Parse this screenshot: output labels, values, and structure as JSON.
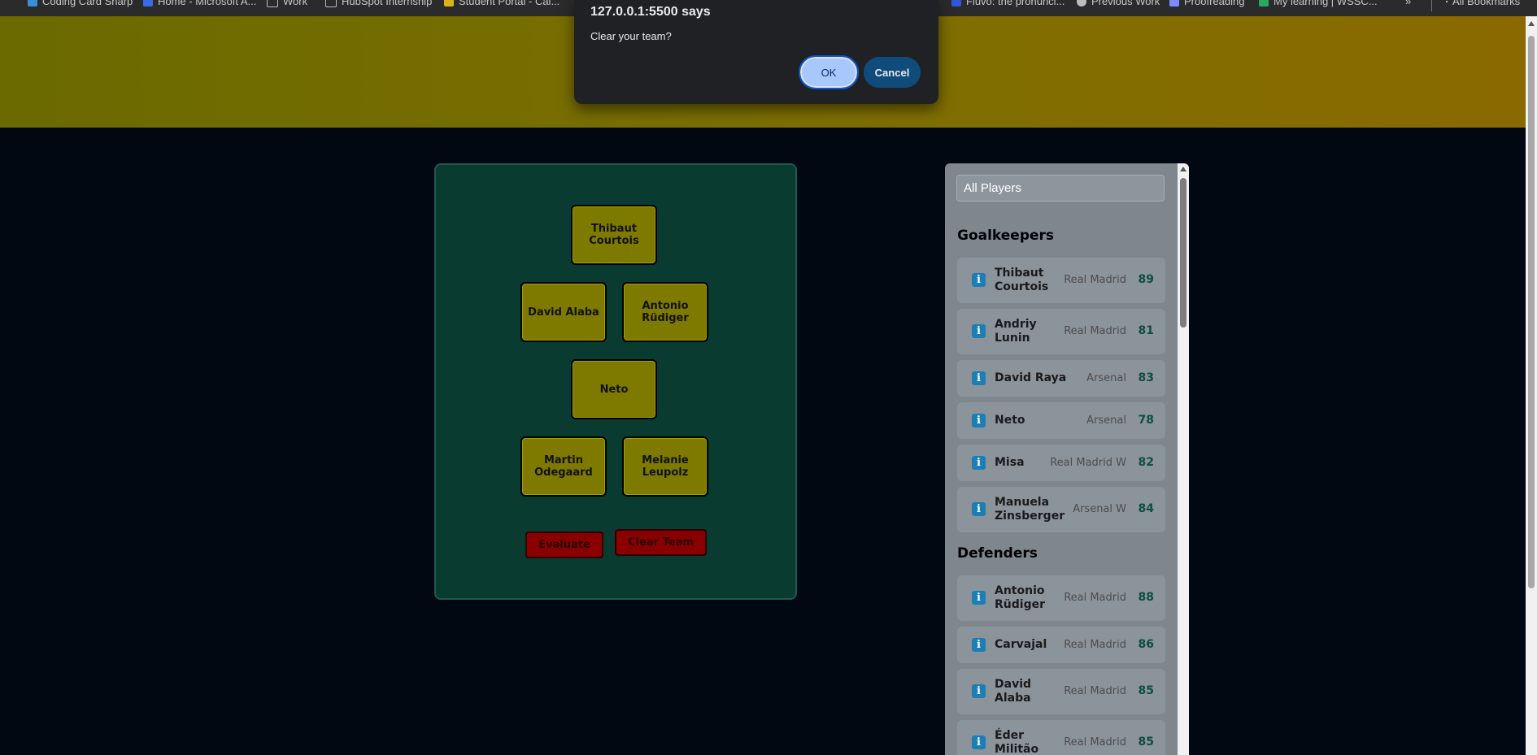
{
  "bookmarks": {
    "items": [
      {
        "label": "Coding Card Sharp",
        "color": "#3a8fd8"
      },
      {
        "label": "Home - Microsoft A...",
        "color": "#3c6ae0"
      },
      {
        "label": "Work",
        "color": "#9a9a9a"
      },
      {
        "label": "HubSpot Internship",
        "color": "#9a9a9a"
      },
      {
        "label": "Student Portal - Cal...",
        "color": "#d8b31c"
      },
      {
        "label": "Fluvo: the pronunci...",
        "color": "#3355dd"
      },
      {
        "label": "Previous Work",
        "color": "#bdbdbd"
      },
      {
        "label": "Proofreading",
        "color": "#7b8cff"
      },
      {
        "label": "My learning | WSSC...",
        "color": "#2aa860"
      }
    ],
    "overflow": "»",
    "all_bookmarks": "All Bookmarks"
  },
  "dialog": {
    "title": "127.0.0.1:5500 says",
    "message": "Clear your team?",
    "ok_label": "OK",
    "cancel_label": "Cancel"
  },
  "pitch": {
    "slots": [
      {
        "name": "Thibaut Courtois"
      },
      {
        "name": "David Alaba"
      },
      {
        "name": "Antonio Rüdiger"
      },
      {
        "name": "Neto"
      },
      {
        "name": "Martin Odegaard"
      },
      {
        "name": "Melanie Leupolz"
      }
    ],
    "evaluate_label": "Evaluate",
    "clear_label": "Clear Team"
  },
  "player_list": {
    "filter_value": "All Players",
    "sections": [
      {
        "title": "Goalkeepers",
        "players": [
          {
            "name": "Thibaut Courtois",
            "club": "Real Madrid",
            "rating": "89"
          },
          {
            "name": "Andriy Lunin",
            "club": "Real Madrid",
            "rating": "81"
          },
          {
            "name": "David Raya",
            "club": "Arsenal",
            "rating": "83"
          },
          {
            "name": "Neto",
            "club": "Arsenal",
            "rating": "78"
          },
          {
            "name": "Misa",
            "club": "Real Madrid W",
            "rating": "82"
          },
          {
            "name": "Manuela Zinsberger",
            "club": "Arsenal W",
            "rating": "84"
          }
        ]
      },
      {
        "title": "Defenders",
        "players": [
          {
            "name": "Antonio Rüdiger",
            "club": "Real Madrid",
            "rating": "88"
          },
          {
            "name": "Carvajal",
            "club": "Real Madrid",
            "rating": "86"
          },
          {
            "name": "David Alaba",
            "club": "Real Madrid",
            "rating": "85"
          },
          {
            "name": "Éder Militão",
            "club": "Real Madrid",
            "rating": "85"
          }
        ]
      }
    ],
    "colors": {
      "rating": "#0c4e3f",
      "info_icon": "#1d7db5"
    }
  }
}
